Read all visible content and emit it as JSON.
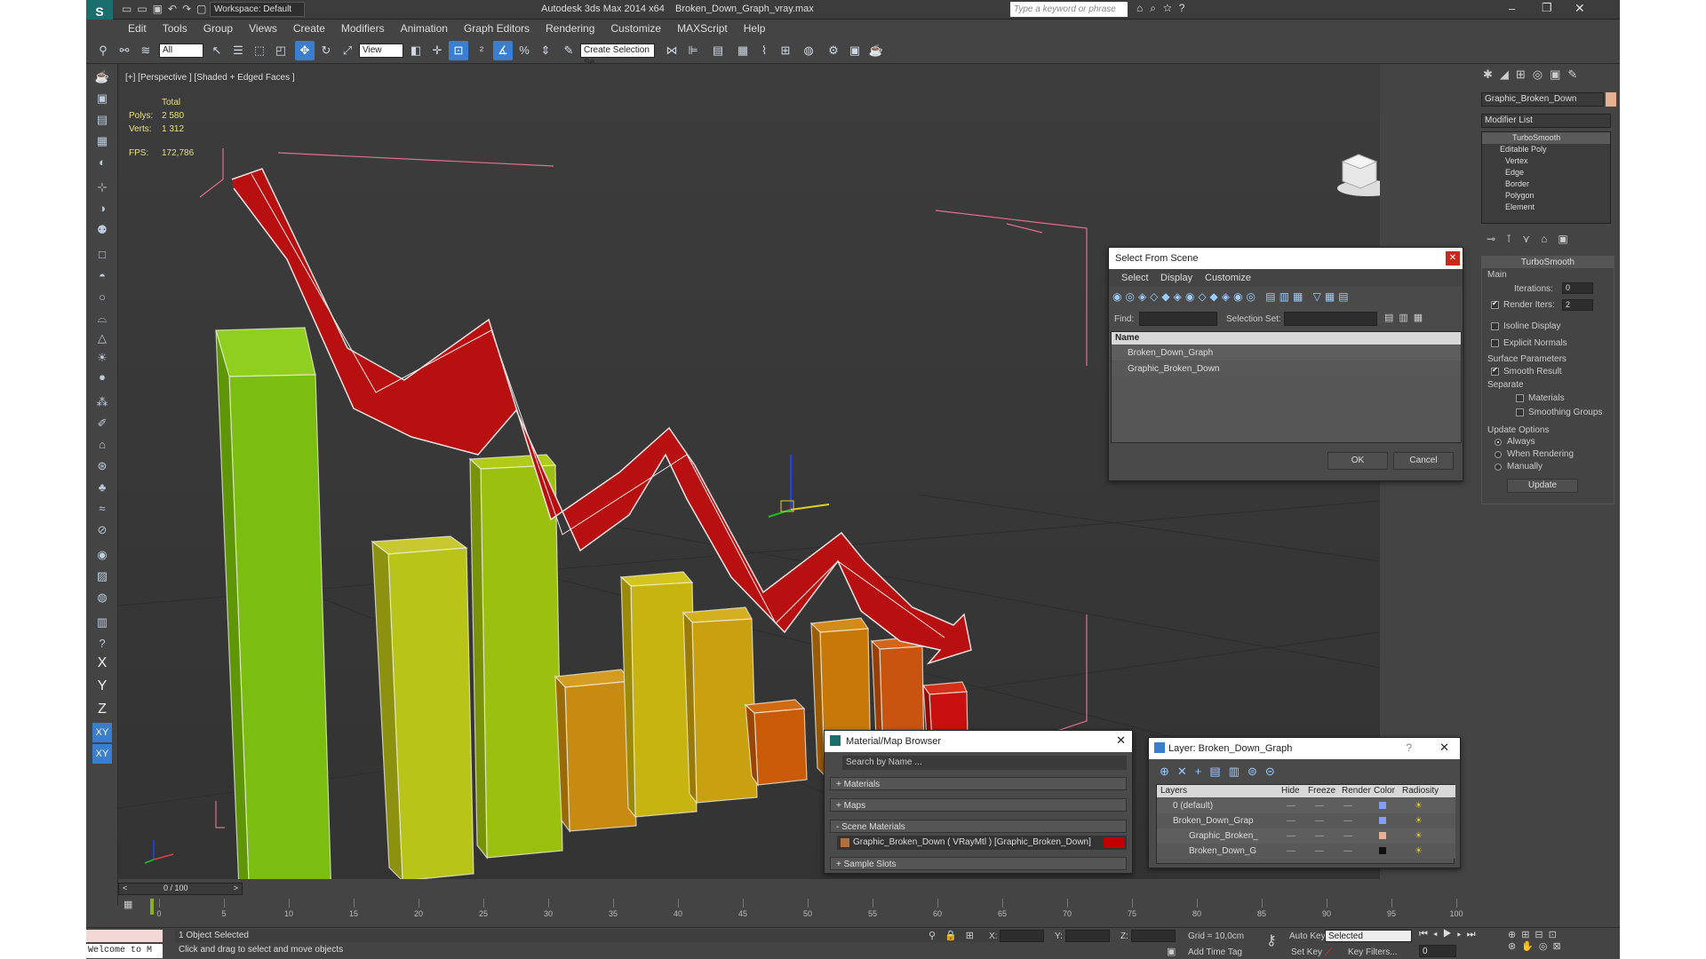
{
  "title": {
    "app": "Autodesk 3ds Max  2014 x64",
    "file": "Broken_Down_Graph_vray.max",
    "workspace": "Workspace: Default",
    "search_placeholder": "Type a keyword or phrase"
  },
  "menu": [
    "Edit",
    "Tools",
    "Group",
    "Views",
    "Create",
    "Modifiers",
    "Animation",
    "Graph Editors",
    "Rendering",
    "Customize",
    "MAXScript",
    "Help"
  ],
  "toolbar": {
    "filter": "All",
    "ref_coord": "View",
    "selection_set": "Create Selection Se"
  },
  "viewport": {
    "label": "[+] [Perspective ] [Shaded + Edged Faces ]",
    "stats": {
      "total": "Total",
      "polys_label": "Polys:",
      "polys": "2 580",
      "verts_label": "Verts:",
      "verts": "1 312",
      "fps_label": "FPS:",
      "fps": "172,786"
    }
  },
  "select_dialog": {
    "title": "Select From Scene",
    "menu": [
      "Select",
      "Display",
      "Customize"
    ],
    "find_label": "Find:",
    "selset_label": "Selection Set:",
    "column": "Name",
    "items": [
      "Broken_Down_Graph",
      "Graphic_Broken_Down"
    ],
    "ok": "OK",
    "cancel": "Cancel"
  },
  "material_browser": {
    "title": "Material/Map Browser",
    "search": "Search by Name ...",
    "sections": [
      "+ Materials",
      "+ Maps",
      "- Scene Materials",
      "+ Sample Slots"
    ],
    "scene_material": "Graphic_Broken_Down  ( VRayMtl )  [Graphic_Broken_Down]",
    "swatch": "#c00000"
  },
  "layer_dialog": {
    "title": "Layer: Broken_Down_Graph",
    "columns": [
      "Layers",
      "Hide",
      "Freeze",
      "Render",
      "Color",
      "Radiosity"
    ],
    "rows": [
      {
        "name": "0 (default)",
        "color": "#7fa0ff"
      },
      {
        "name": "Broken_Down_Grap",
        "color": "#7fa0ff"
      },
      {
        "name": "Graphic_Broken_",
        "color": "#e8b090"
      },
      {
        "name": "Broken_Down_G",
        "color": "#111111"
      }
    ]
  },
  "command_panel": {
    "object_name": "Graphic_Broken_Down",
    "object_color": "#e8b090",
    "modifier_list": "Modifier List",
    "stack": [
      "TurboSmooth",
      "Editable Poly",
      "Vertex",
      "Edge",
      "Border",
      "Polygon",
      "Element"
    ],
    "rollout_title": "TurboSmooth",
    "main": "Main",
    "iterations_label": "Iterations:",
    "iterations": "0",
    "render_iters_label": "Render Iters:",
    "render_iters": "2",
    "isoline": "Isoline Display",
    "explicit_normals": "Explicit Normals",
    "surface_params": "Surface Parameters",
    "smooth_result": "Smooth Result",
    "separate": "Separate",
    "materials": "Materials",
    "smoothing_groups": "Smoothing Groups",
    "update_options": "Update Options",
    "always": "Always",
    "when_rendering": "When Rendering",
    "manually": "Manually",
    "update": "Update"
  },
  "timeline": {
    "frame": "0 / 100",
    "ticks": [
      "0",
      "5",
      "10",
      "15",
      "20",
      "25",
      "30",
      "35",
      "40",
      "45",
      "50",
      "55",
      "60",
      "65",
      "70",
      "75",
      "80",
      "85",
      "90",
      "95",
      "100"
    ]
  },
  "status": {
    "maxscript": "Welcome to M",
    "selected": "1 Object Selected",
    "prompt": "Click and drag to select and move objects",
    "x_label": "X:",
    "y_label": "Y:",
    "z_label": "Z:",
    "grid": "Grid = 10,0cm",
    "add_time_tag": "Add Time Tag",
    "auto_key": "Auto Key",
    "set_key": "Set Key",
    "key_mode": "Selected",
    "key_filters": "Key Filters...",
    "frame_value": "0"
  },
  "axis_labels": [
    "X",
    "Y",
    "Z",
    "XY",
    "XY"
  ]
}
